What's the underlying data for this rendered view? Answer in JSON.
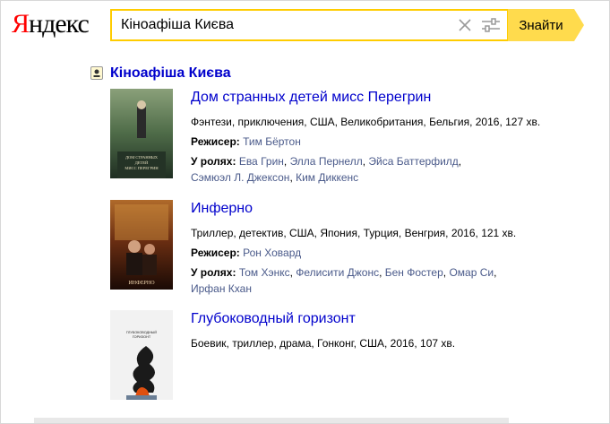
{
  "logo": {
    "first": "Я",
    "rest": "ндекс"
  },
  "search": {
    "query": "Кіноафіша Києва",
    "button_label": "Знайти"
  },
  "result": {
    "title": "Кіноафіша Києва",
    "movies": [
      {
        "title": "Дом странных детей мисс Перегрин",
        "info": "Фэнтези, приключения, США, Великобритания, Бельгия, 2016, 127 хв.",
        "director_label": "Режисер:",
        "director": "Тим Бёртон",
        "cast_label": "У ролях:",
        "cast": [
          "Ева Грин",
          "Элла Пернелл",
          "Эйса Баттерфилд",
          "Сэмюэл Л. Джексон",
          "Ким Диккенс"
        ],
        "poster_text": [
          "ДОМ СТРАННЫХ",
          "ДЕТЕЙ",
          "МИСС ПЕРЕГРИН"
        ]
      },
      {
        "title": "Инферно",
        "info": "Триллер, детектив, США, Япония, Турция, Венгрия, 2016, 121 хв.",
        "director_label": "Режисер:",
        "director": "Рон Ховард",
        "cast_label": "У ролях:",
        "cast": [
          "Том Хэнкс",
          "Фелисити Джонс",
          "Бен Фостер",
          "Омар Си",
          "Ирфан Кхан"
        ],
        "poster_text": [
          "ИНФЕРНО"
        ]
      },
      {
        "title": "Глубоководный горизонт",
        "info": "Боевик, триллер, драма, Гонконг, США, 2016, 107 хв.",
        "poster_text": [
          "ГЛУБОКОВОДНЫЙ",
          "ГОРИЗОНТ"
        ]
      }
    ]
  }
}
